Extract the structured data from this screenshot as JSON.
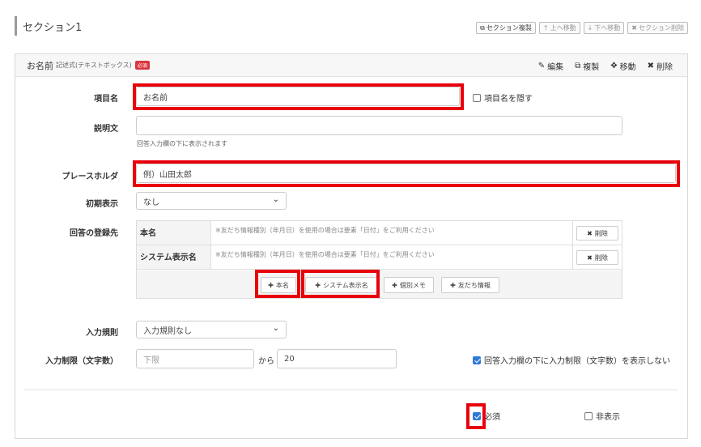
{
  "section": {
    "title": "セクション1",
    "actions": [
      {
        "icon": "copy-icon",
        "label": "セクション複製",
        "enabled": true
      },
      {
        "icon": "arrow-up-icon",
        "label": "上へ移動",
        "enabled": false
      },
      {
        "icon": "arrow-down-icon",
        "label": "下へ移動",
        "enabled": false
      },
      {
        "icon": "close-icon",
        "label": "セクション削除",
        "enabled": false
      }
    ]
  },
  "field_card": {
    "title": "お名前",
    "type_label": "記述式(テキストボックス)",
    "required_badge": "必須",
    "actions": {
      "edit": "編集",
      "copy": "複製",
      "move": "移動",
      "delete": "削除"
    }
  },
  "form": {
    "item_name_label": "項目名",
    "item_name_value": "お名前",
    "hide_name_label": "項目名を隠す",
    "hide_name_checked": false,
    "description_label": "説明文",
    "description_value": "",
    "description_hint": "回答入力欄の下に表示されます",
    "placeholder_label": "プレースホルダ",
    "placeholder_value": "例）山田太郎",
    "initial_label": "初期表示",
    "initial_value": "なし",
    "destination_label": "回答の登録先",
    "destinations": [
      {
        "name": "本名",
        "note": "※友だち情報種別（年月日）を使用の場合は要素「日付」をご利用ください",
        "delete": "削除"
      },
      {
        "name": "システム表示名",
        "note": "※友だち情報種別（年月日）を使用の場合は要素「日付」をご利用ください",
        "delete": "削除"
      }
    ],
    "add_buttons": {
      "real_name": "本名",
      "system_name": "システム表示名",
      "memo": "個別メモ",
      "friend_info": "友だち情報"
    },
    "rule_label": "入力規則",
    "rule_value": "入力規則なし",
    "limit_label": "入力制限（文字数）",
    "limit_min_placeholder": "下限",
    "limit_from": "から",
    "limit_max_value": "20",
    "hide_limit_label": "回答入力欄の下に入力制限（文字数）を表示しない",
    "hide_limit_checked": true,
    "required_label": "必須",
    "required_checked": true,
    "hidden_label": "非表示",
    "hidden_checked": false
  }
}
